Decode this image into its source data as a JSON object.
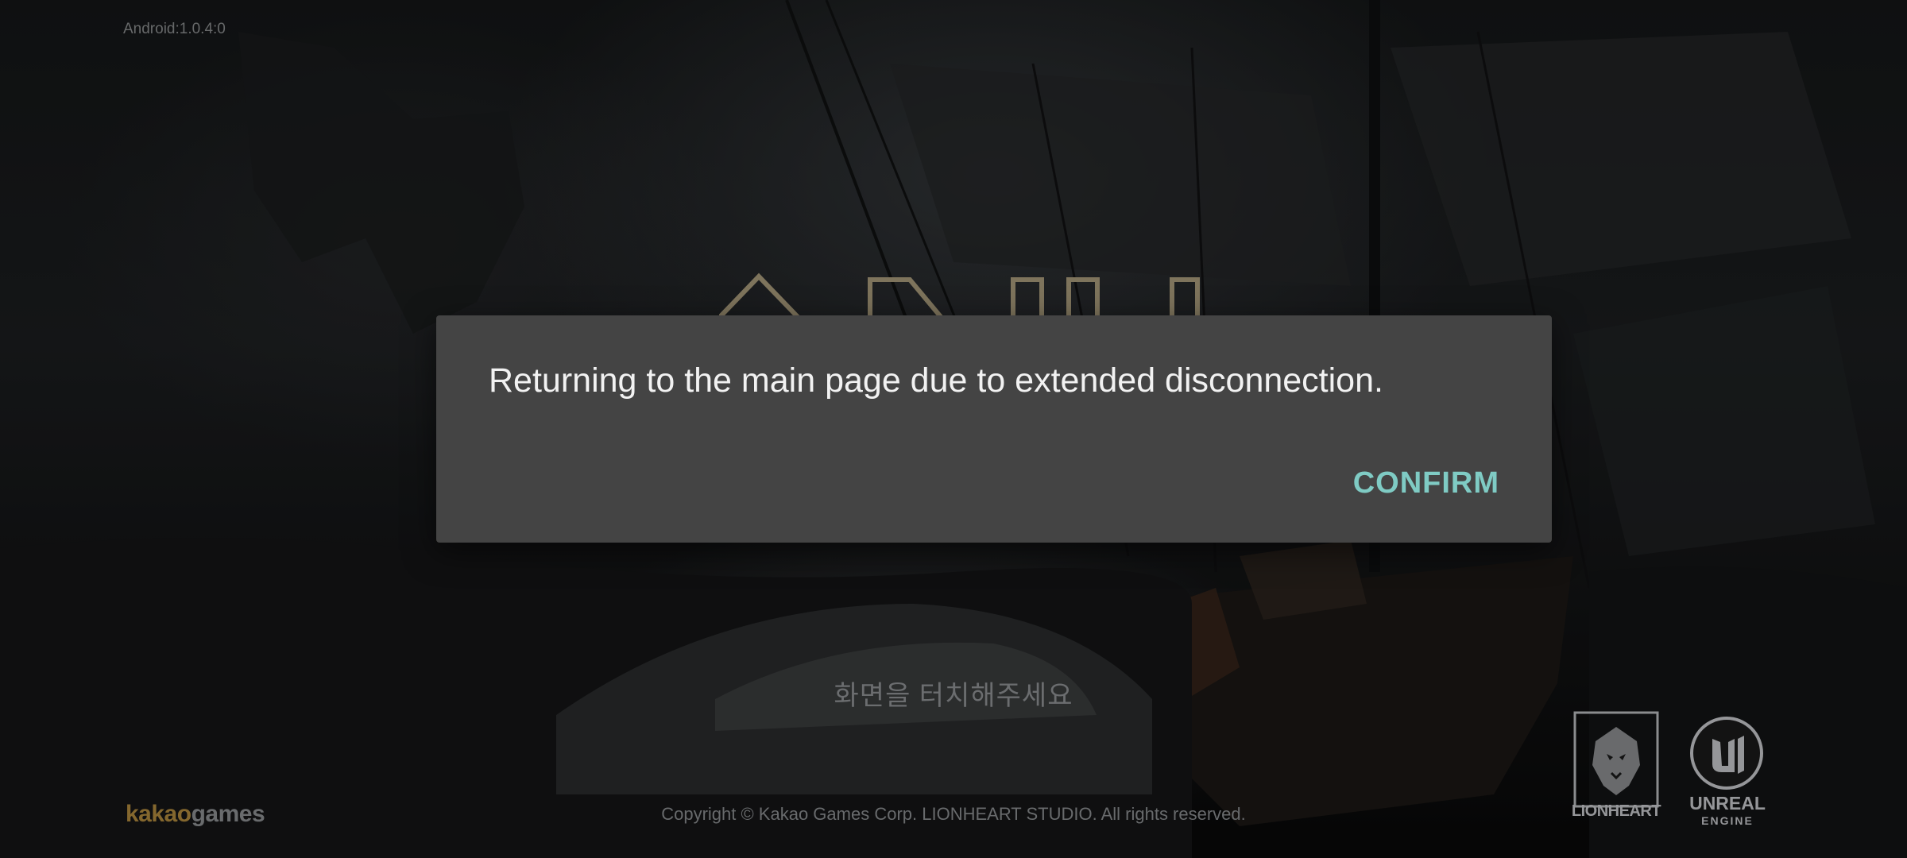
{
  "header": {
    "version_label": "Android:1.0.4:0"
  },
  "game": {
    "touch_prompt": "화면을 터치해주세요",
    "copyright": "Copyright © Kakao Games Corp. LIONHEART STUDIO. All rights reserved."
  },
  "logos": {
    "publisher_part1": "kakao",
    "publisher_part2": "games",
    "studio": "LIONHEART",
    "engine": "UNREAL",
    "engine_sub": "ENGINE"
  },
  "dialog": {
    "message": "Returning to the main page due to extended disconnection.",
    "confirm_label": "CONFIRM"
  },
  "colors": {
    "dialog_background": "#444444",
    "confirm_accent": "#7fcbc4",
    "kakao_brand": "#b08a3e"
  }
}
